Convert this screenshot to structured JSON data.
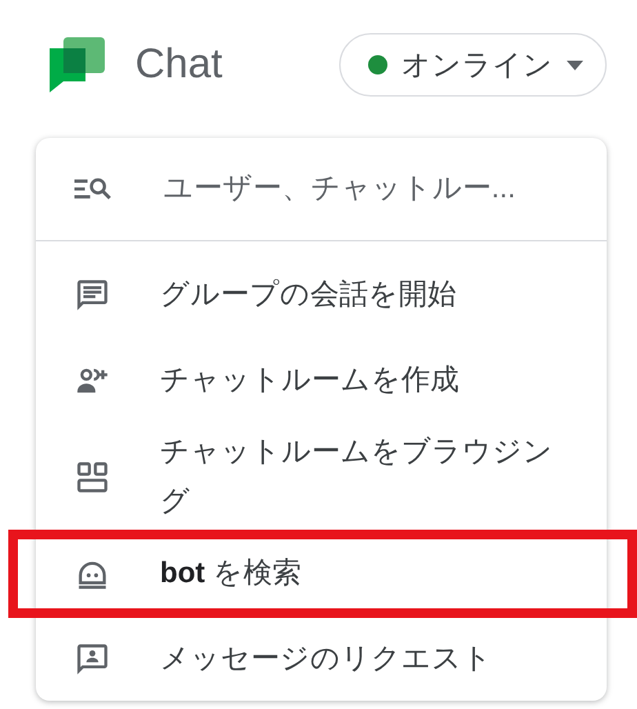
{
  "app": {
    "title": "Chat"
  },
  "status": {
    "label": "オンライン",
    "online": true
  },
  "search": {
    "placeholder": "ユーザー、チャットルー..."
  },
  "items": [
    {
      "label": "グループの会話を開始",
      "highlighted": false
    },
    {
      "label": "チャットルームを作成",
      "highlighted": false
    },
    {
      "label": "チャットルームをブラウジング",
      "highlighted": false
    },
    {
      "label": "**bot** を検索",
      "highlighted": true
    },
    {
      "label": "メッセージのリクエスト",
      "highlighted": false
    }
  ]
}
